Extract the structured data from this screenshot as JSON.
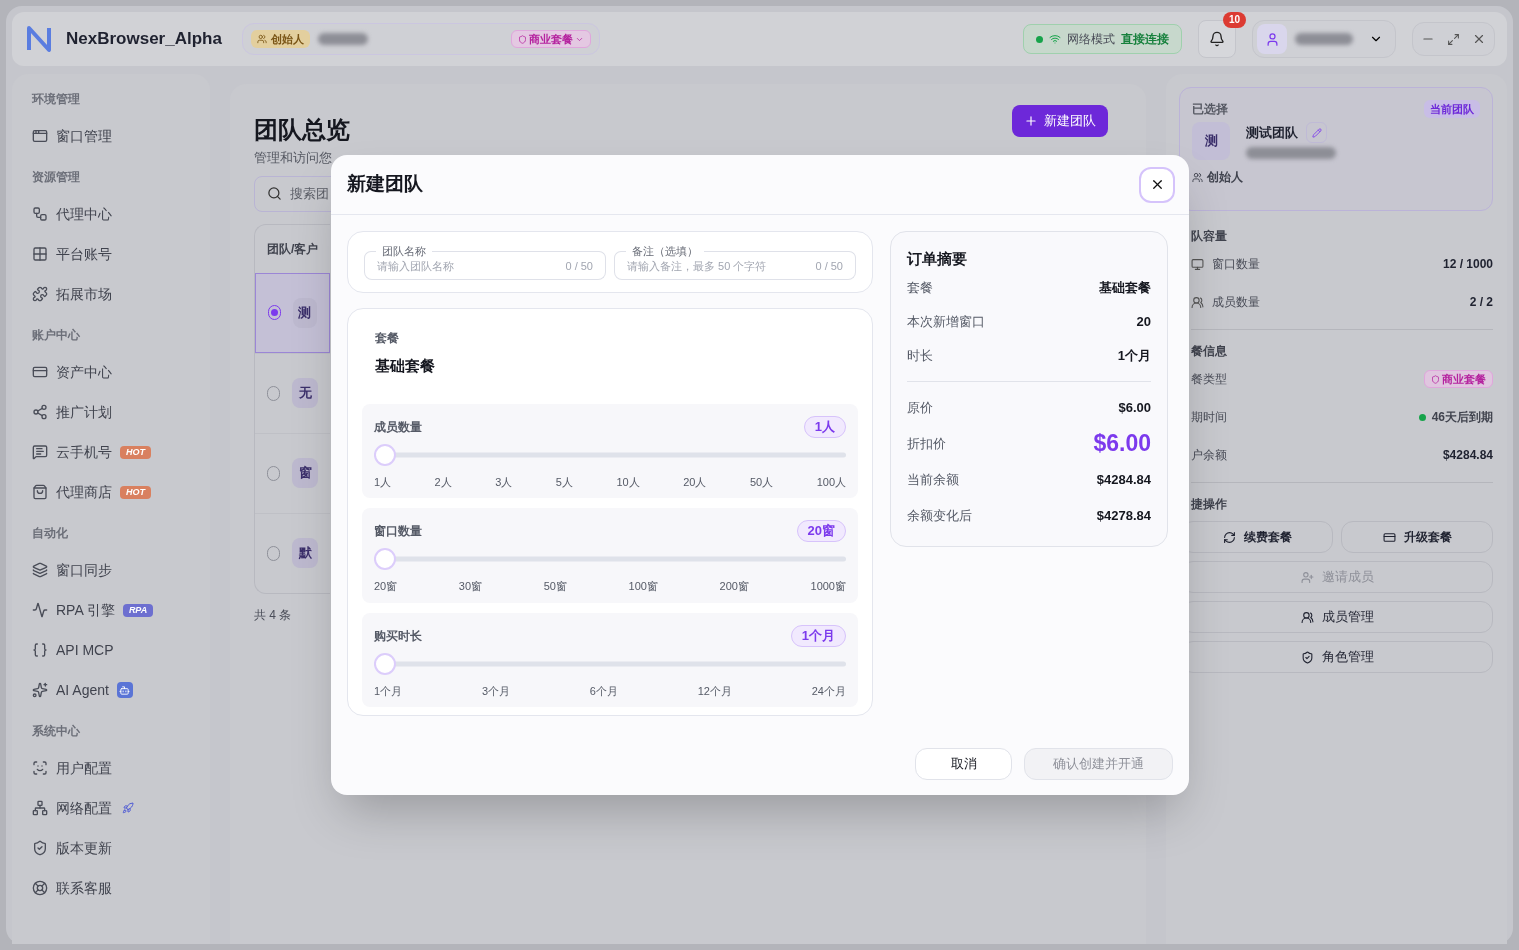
{
  "app": {
    "name": "NexBrowser_Alpha",
    "role_badge": "创始人",
    "plan_badge": "商业套餐"
  },
  "header": {
    "network_label": "网络模式",
    "network_value": "直接连接",
    "notifications": "10"
  },
  "sidebar": {
    "sections": [
      {
        "title": "环境管理",
        "items": [
          {
            "label": "窗口管理"
          }
        ]
      },
      {
        "title": "资源管理",
        "items": [
          {
            "label": "代理中心"
          },
          {
            "label": "平台账号"
          },
          {
            "label": "拓展市场"
          }
        ]
      },
      {
        "title": "账户中心",
        "items": [
          {
            "label": "资产中心"
          },
          {
            "label": "推广计划"
          },
          {
            "label": "云手机号",
            "badge": {
              "kind": "hot",
              "text": "HOT"
            }
          },
          {
            "label": "代理商店",
            "badge": {
              "kind": "hot",
              "text": "HOT"
            }
          }
        ]
      },
      {
        "title": "自动化",
        "items": [
          {
            "label": "窗口同步"
          },
          {
            "label": "RPA 引擎",
            "badge": {
              "kind": "rpa",
              "text": "RPA"
            }
          },
          {
            "label": "API MCP"
          },
          {
            "label": "AI Agent",
            "badge": {
              "kind": "ai"
            }
          }
        ]
      },
      {
        "title": "系统中心",
        "items": [
          {
            "label": "用户配置"
          },
          {
            "label": "网络配置",
            "badge": {
              "kind": "rocket"
            }
          },
          {
            "label": "版本更新"
          },
          {
            "label": "联系客服"
          }
        ]
      }
    ]
  },
  "main": {
    "title": "团队总览",
    "subtitle": "管理和访问您",
    "new_button": "新建团队",
    "search": {
      "placeholder": "搜索团"
    },
    "table": {
      "columns": [
        "团队/客户"
      ],
      "rows": [
        {
          "avatar": "测",
          "selected": true
        },
        {
          "avatar": "无",
          "selected": false
        },
        {
          "avatar": "窗",
          "selected": false
        },
        {
          "avatar": "默",
          "selected": false
        }
      ]
    },
    "total": "共 4 条"
  },
  "details": {
    "selected_label": "已选择",
    "current_badge": "当前团队",
    "avatar": "测",
    "team_name": "测试团队",
    "role": "创始人",
    "capacity_title": "队容量",
    "capacity": [
      {
        "label": "窗口数量",
        "value": "12 / 1000"
      },
      {
        "label": "成员数量",
        "value": "2 / 2"
      }
    ],
    "plan_title": "餐信息",
    "plan": [
      {
        "kind": "badge",
        "label": "餐类型",
        "value": "商业套餐"
      },
      {
        "kind": "status",
        "label": "期时间",
        "value": "46天后到期",
        "color": "#16a34a"
      },
      {
        "kind": "text",
        "label": "户余额",
        "value": "$4284.84"
      }
    ],
    "quick_title": "捷操作",
    "actions": [
      {
        "label": "续费套餐",
        "disabled": false
      },
      {
        "label": "升级套餐",
        "disabled": false
      },
      {
        "label": "邀请成员",
        "disabled": true
      },
      {
        "label": "成员管理",
        "disabled": false
      },
      {
        "label": "角色管理",
        "disabled": false
      }
    ]
  },
  "modal": {
    "title": "新建团队",
    "fields": [
      {
        "label": "团队名称",
        "placeholder": "请输入团队名称",
        "counter": "0 / 50"
      },
      {
        "label": "备注（选填）",
        "placeholder": "请输入备注，最多 50 个字符",
        "counter": "0 / 50"
      }
    ],
    "plan_label": "套餐",
    "plan_value": "基础套餐",
    "sliders": [
      {
        "label": "成员数量",
        "value": "1人",
        "level": 0,
        "ticks": [
          "1人",
          "2人",
          "3人",
          "5人",
          "10人",
          "20人",
          "50人",
          "100人"
        ]
      },
      {
        "label": "窗口数量",
        "value": "20窗",
        "level": 0,
        "ticks": [
          "20窗",
          "30窗",
          "50窗",
          "100窗",
          "200窗",
          "1000窗"
        ]
      },
      {
        "label": "购买时长",
        "value": "1个月",
        "level": 0,
        "ticks": [
          "1个月",
          "3个月",
          "6个月",
          "12个月",
          "24个月"
        ]
      }
    ],
    "summary": {
      "title": "订单摘要",
      "rows_top": [
        {
          "label": "套餐",
          "value": "基础套餐"
        },
        {
          "label": "本次新增窗口",
          "value": "20"
        },
        {
          "label": "时长",
          "value": "1个月"
        }
      ],
      "rows_bottom": [
        {
          "label": "原价",
          "value": "$6.00",
          "emphasis": false
        },
        {
          "label": "折扣价",
          "value": "$6.00",
          "emphasis": true
        },
        {
          "label": "当前余额",
          "value": "$4284.84",
          "emphasis": false
        },
        {
          "label": "余额变化后",
          "value": "$4278.84",
          "emphasis": false
        }
      ]
    },
    "cancel": "取消",
    "confirm": {
      "label": "确认创建并开通",
      "disabled": true
    }
  }
}
